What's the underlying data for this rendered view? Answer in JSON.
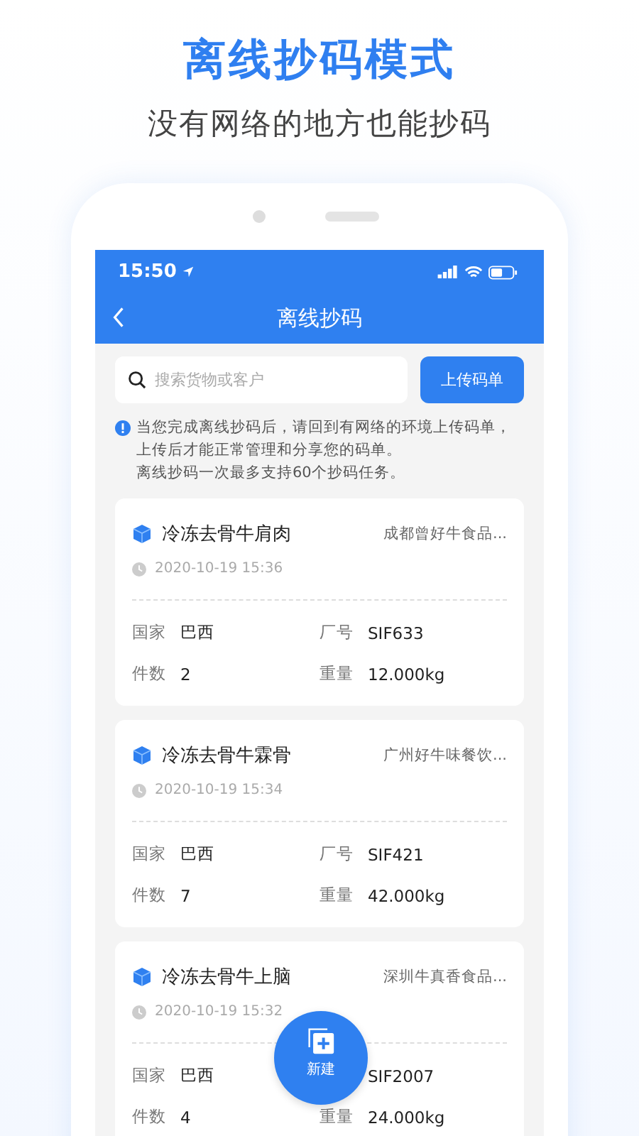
{
  "headline": "离线抄码模式",
  "subheadline": "没有网络的地方也能抄码",
  "status_bar": {
    "time": "15:50"
  },
  "nav": {
    "title": "离线抄码"
  },
  "search": {
    "placeholder": "搜索货物或客户"
  },
  "upload_button": "上传码单",
  "notice": [
    "当您完成离线抄码后，请回到有网络的环境上传码单，上传后才能正常管理和分享您的码单。",
    "离线抄码一次最多支持60个抄码任务。"
  ],
  "cards": [
    {
      "product": "冷冻去骨牛肩肉",
      "customer": "成都曾好牛食品...",
      "time": "2020-10-19 15:36",
      "country_label": "国家",
      "country": "巴西",
      "factory_label": "厂号",
      "factory": "SIF633",
      "count_label": "件数",
      "count": "2",
      "weight_label": "重量",
      "weight": "12.000kg"
    },
    {
      "product": "冷冻去骨牛霖骨",
      "customer": "广州好牛味餐饮...",
      "time": "2020-10-19 15:34",
      "country_label": "国家",
      "country": "巴西",
      "factory_label": "厂号",
      "factory": "SIF421",
      "count_label": "件数",
      "count": "7",
      "weight_label": "重量",
      "weight": "42.000kg"
    },
    {
      "product": "冷冻去骨牛上脑",
      "customer": "深圳牛真香食品...",
      "time": "2020-10-19 15:32",
      "country_label": "国家",
      "country": "巴西",
      "factory": "SIF2007",
      "count_label": "件数",
      "count": "4",
      "weight_label": "重量",
      "weight": "24.000kg"
    }
  ],
  "fab": {
    "label": "新建"
  }
}
